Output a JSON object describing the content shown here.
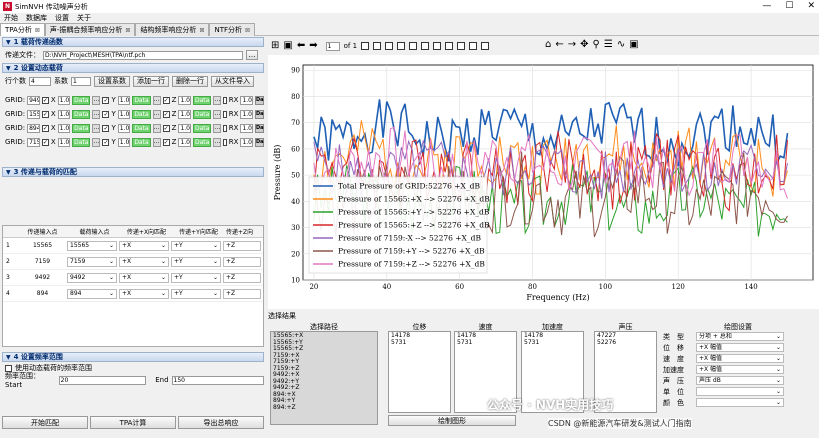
{
  "window": {
    "title": "SimNVH 传动噪声分析"
  },
  "menu": [
    "开始",
    "数据库",
    "设置",
    "关于"
  ],
  "tabs": [
    {
      "label": "TPA分析",
      "active": true
    },
    {
      "label": "声-振耦合频率响应分析",
      "active": false
    },
    {
      "label": "结构频率响应分析",
      "active": false
    },
    {
      "label": "NTF分析",
      "active": false
    }
  ],
  "sec1": {
    "title": "1 载荷传递函数",
    "file_label": "传递文件：",
    "file_value": "D:\\NVH_Project\\MESH\\TPA\\ntf.pch"
  },
  "sec2": {
    "title": "2 设置动态载荷",
    "count_label": "行个数",
    "count_value": "4",
    "coef_label": "系数",
    "coef_value": "1",
    "btn_set": "设置系数",
    "btn_add": "添加一行",
    "btn_del": "删除一行",
    "btn_import": "从文件导入",
    "grid_label": "GRID:",
    "one": "1.0",
    "data_label": "Data",
    "rx_label": "RX",
    "db_label": "Da",
    "axes": [
      "X",
      "Y",
      "Z"
    ],
    "grids": [
      "9492",
      "15565",
      "894",
      "7159"
    ]
  },
  "sec3": {
    "title": "3 传递与载荷的匹配",
    "headers": [
      "传递输入点",
      "载荷输入点",
      "传递+X向匹配",
      "传递+Y向匹配",
      "传递+Z向"
    ],
    "rows": [
      {
        "idx": "1",
        "t": "15565",
        "l": "15565",
        "x": "+X",
        "y": "+Y",
        "z": "+Z"
      },
      {
        "idx": "2",
        "t": "7159",
        "l": "7159",
        "x": "+X",
        "y": "+Y",
        "z": "+Z"
      },
      {
        "idx": "3",
        "t": "9492",
        "l": "9492",
        "x": "+X",
        "y": "+Y",
        "z": "+Z"
      },
      {
        "idx": "4",
        "t": "894",
        "l": "894",
        "x": "+X",
        "y": "+Y",
        "z": "+Z"
      }
    ]
  },
  "sec4": {
    "title": "4 设置频率范围",
    "use_dyn": "使用动态载荷的频率范围",
    "freq_label": "频率范围：Start",
    "start": "20",
    "end_label": "End",
    "end": "150"
  },
  "bottom_buttons": [
    "开始匹配",
    "TPA计算",
    "导出总响应"
  ],
  "toolbar": {
    "page": "1",
    "of": "of 1"
  },
  "results": {
    "title": "选择结果",
    "path_label": "选择路径",
    "paths": [
      "15565:+X",
      "15565:+Y",
      "15565:+Z",
      "7159:+X",
      "7159:+Y",
      "7159:+Z",
      "9492:+X",
      "9492:+Y",
      "9492:+Z",
      "894:+X",
      "894:+Y",
      "894:+Z"
    ],
    "disp_label": "位移",
    "disp": [
      "14178",
      "5731"
    ],
    "vel_label": "速度",
    "vel": [
      "14178",
      "5731"
    ],
    "acc_label": "加速度",
    "acc": [
      "14178",
      "5731"
    ],
    "pres_label": "声压",
    "pres": [
      "47227",
      "52276"
    ],
    "plot_btn": "绘制图形",
    "settings_title": "绘图设置",
    "props": [
      {
        "label": "类　型",
        "value": "分项 + 总和"
      },
      {
        "label": "位　移",
        "value": "+X 幅值"
      },
      {
        "label": "速　度",
        "value": "+X 幅值"
      },
      {
        "label": "加速度",
        "value": "+X 幅值"
      },
      {
        "label": "声　压",
        "value": "声压 dB"
      },
      {
        "label": "单　位",
        "value": ""
      },
      {
        "label": "颜　色",
        "value": ""
      }
    ]
  },
  "watermark": {
    "line1": "公众号 · NVH实用技巧",
    "line2": "CSDN @新能源汽车研发&测试人门指南"
  },
  "chart_data": {
    "type": "line",
    "xlabel": "Frequency (Hz)",
    "ylabel": "Pressure (dB)",
    "xlim": [
      17,
      157
    ],
    "ylim": [
      10,
      92
    ],
    "xticks": [
      20,
      40,
      60,
      80,
      100,
      120,
      140
    ],
    "yticks": [
      10,
      20,
      30,
      40,
      50,
      60,
      70,
      80,
      90
    ],
    "grid": true,
    "legend_position": "lower-left",
    "series": [
      {
        "name": "Total Pressure of GRID:52276 +X_dB",
        "color": "#1f5fb4",
        "base": 66,
        "amp": 10,
        "seed": 1
      },
      {
        "name": "Pressure of 15565:+X --> 52276 +X_dB",
        "color": "#ff8c1a",
        "base": 56,
        "amp": 12,
        "seed": 2
      },
      {
        "name": "Pressure of 15565:+Y --> 52276 +X_dB",
        "color": "#2ca02c",
        "base": 40,
        "amp": 12,
        "seed": 3
      },
      {
        "name": "Pressure of 15565:+Z --> 52276 +X_dB",
        "color": "#d62728",
        "base": 52,
        "amp": 13,
        "seed": 4
      },
      {
        "name": "Pressure of 7159:-X --> 52276 +X_dB",
        "color": "#9467bd",
        "base": 52,
        "amp": 10,
        "seed": 5
      },
      {
        "name": "Pressure of 7159:+Y --> 52276 +X_dB",
        "color": "#8c564b",
        "base": 42,
        "amp": 14,
        "seed": 6
      },
      {
        "name": "Pressure of 7159:+Z --> 52276 +X_dB",
        "color": "#e377c2",
        "base": 55,
        "amp": 11,
        "seed": 7
      }
    ]
  }
}
